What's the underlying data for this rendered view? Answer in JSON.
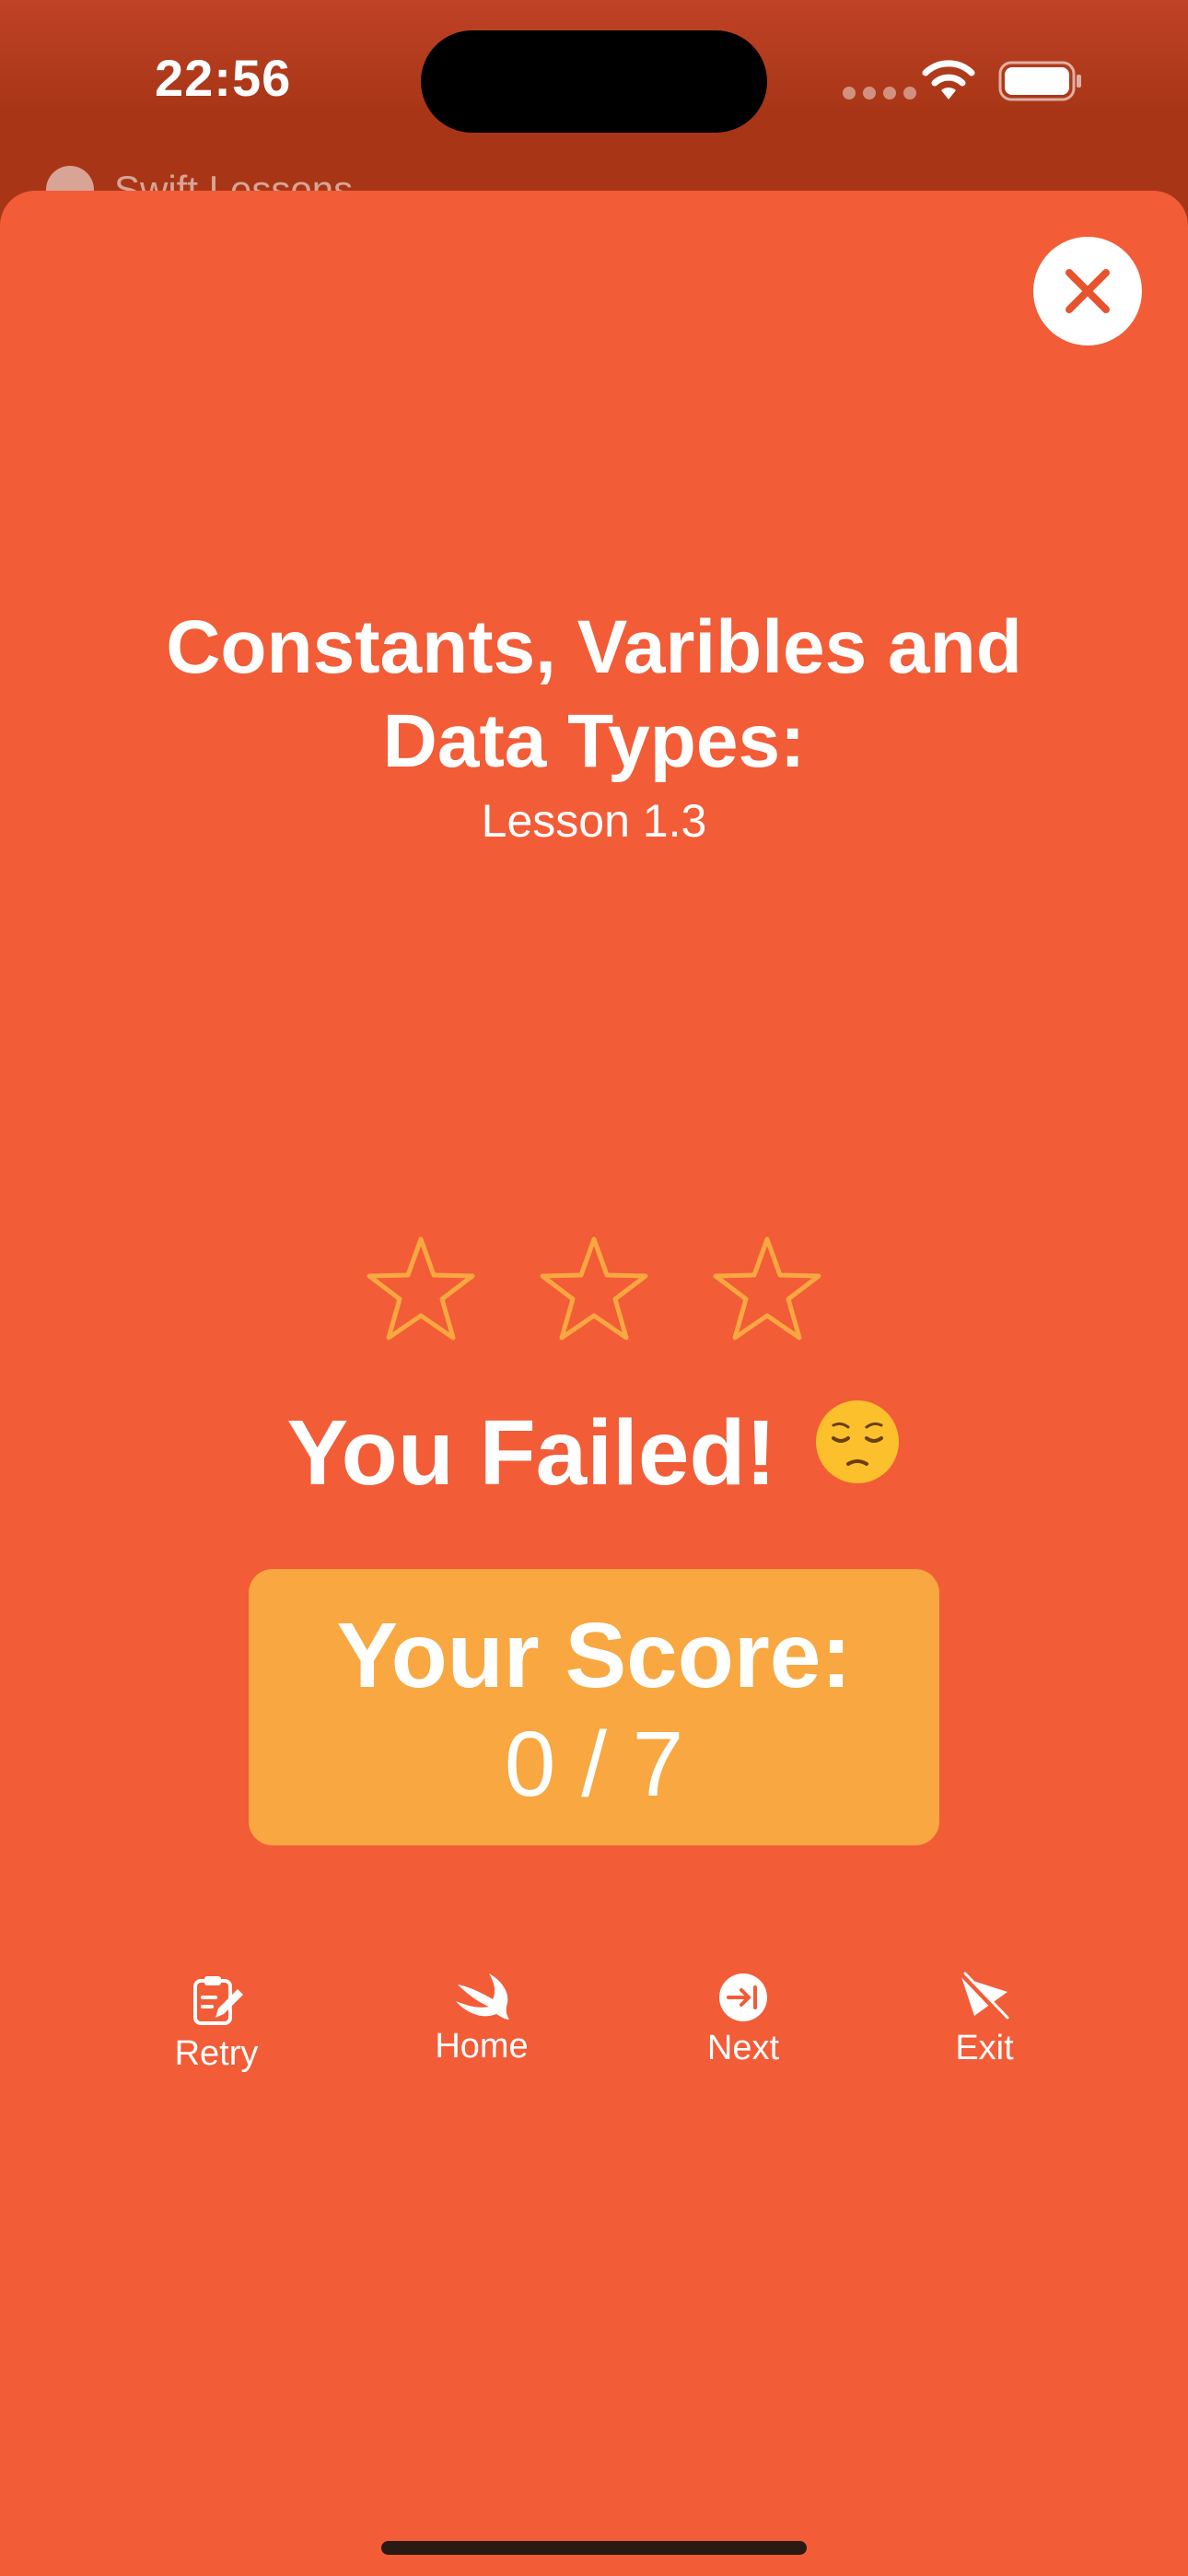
{
  "status_bar": {
    "time": "22:56"
  },
  "nav": {
    "back_label": "Swift Lessons"
  },
  "lesson": {
    "title": "Constants, Varibles and Data Types:",
    "subtitle": "Lesson 1.3"
  },
  "rating": {
    "stars_filled": 0,
    "stars_total": 3
  },
  "result": {
    "message": "You Failed!",
    "emoji": "pensive-face"
  },
  "score": {
    "label": "Your Score:",
    "value": "0 / 7"
  },
  "actions": [
    {
      "label": "Retry",
      "icon": "clipboard-pencil-icon"
    },
    {
      "label": "Home",
      "icon": "swift-bird-icon"
    },
    {
      "label": "Next",
      "icon": "arrow-right-to-line-circle-icon"
    },
    {
      "label": "Exit",
      "icon": "paperplane-slash-icon"
    }
  ],
  "colors": {
    "background": "#f25c37",
    "score_card": "#f8a741",
    "star_outline": "#f8a741",
    "close_x": "#e8532f",
    "text": "#ffffff"
  }
}
